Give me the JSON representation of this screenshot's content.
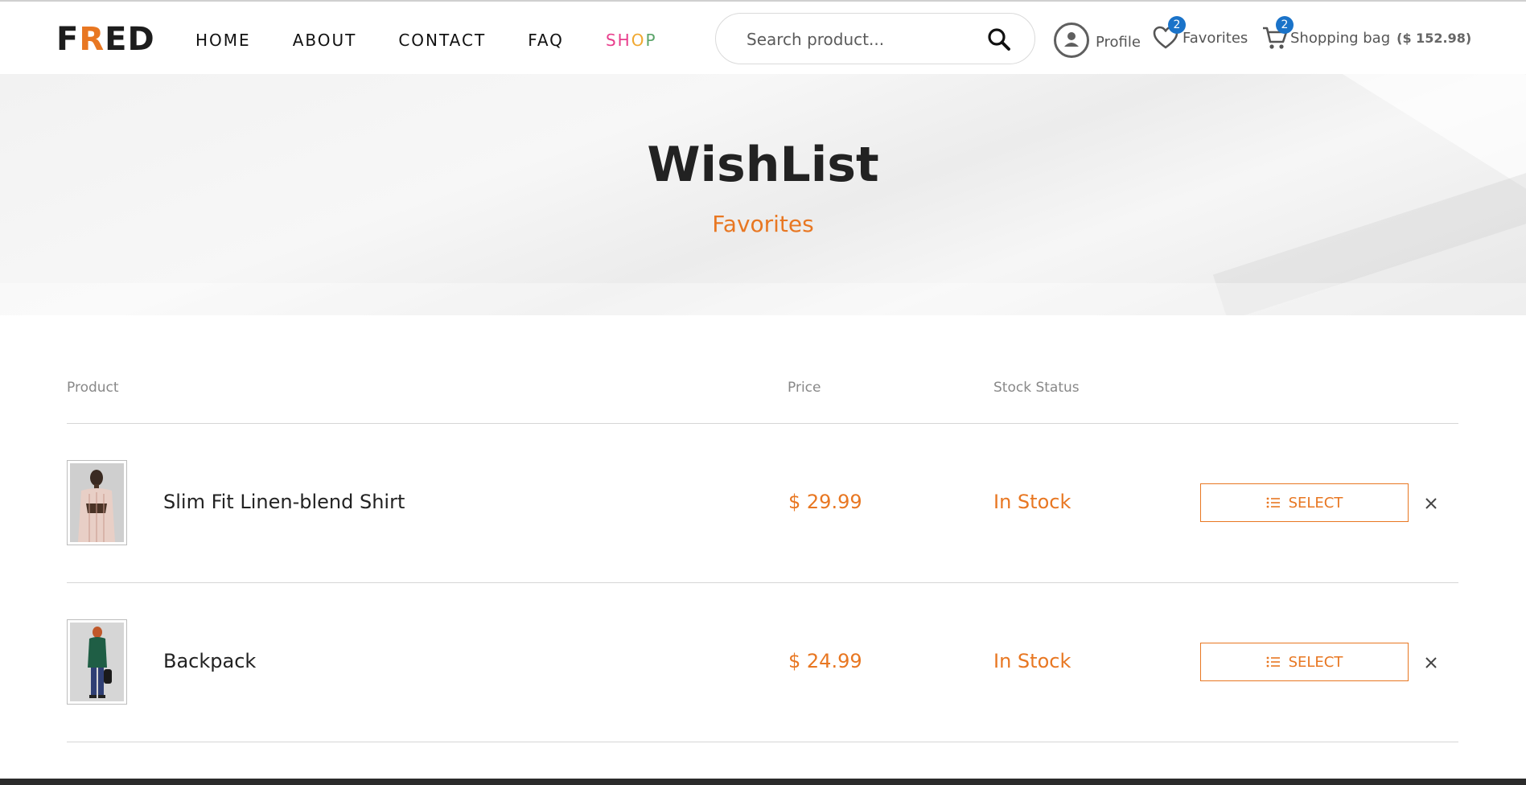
{
  "header": {
    "logo": {
      "first": "F",
      "accent": "R",
      "rest": "ED"
    },
    "nav": [
      {
        "label": "HOME"
      },
      {
        "label": "ABOUT"
      },
      {
        "label": "CONTACT"
      },
      {
        "label": "FAQ"
      }
    ],
    "shop": {
      "letters": [
        "S",
        "H",
        "O",
        "P"
      ],
      "colors": [
        "#e83e8c",
        "#e83e8c",
        "#f0a830",
        "#5aa469"
      ]
    },
    "search": {
      "placeholder": "Search product..."
    },
    "profile_label": "Profile",
    "favorites": {
      "label": "Favorites",
      "count": "2"
    },
    "bag": {
      "label": "Shopping bag",
      "count": "2",
      "total": "($ 152.98)"
    }
  },
  "hero": {
    "title": "WishList",
    "subtitle": "Favorites"
  },
  "table": {
    "headers": {
      "product": "Product",
      "price": "Price",
      "stock": "Stock Status"
    },
    "rows": [
      {
        "name": "Slim Fit Linen-blend Shirt",
        "price": "$ 29.99",
        "stock": "In Stock",
        "button": "SELECT"
      },
      {
        "name": "Backpack",
        "price": "$ 24.99",
        "stock": "In Stock",
        "button": "SELECT"
      }
    ]
  },
  "colors": {
    "accent": "#e87722",
    "badge": "#1a73c9"
  }
}
